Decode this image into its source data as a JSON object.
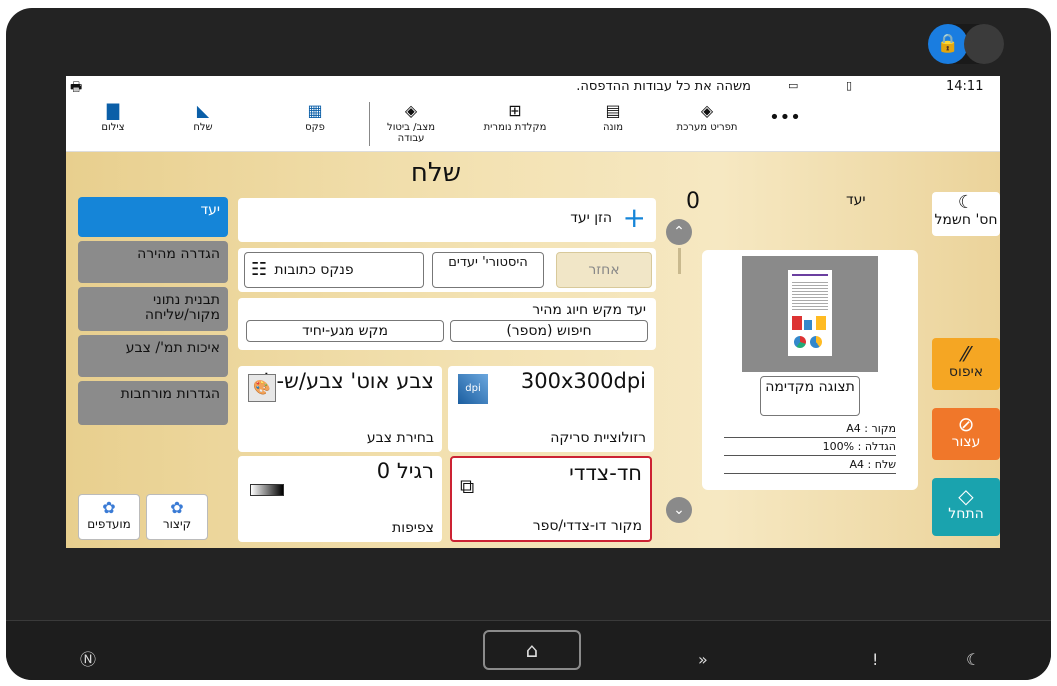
{
  "status": {
    "message": "משהה את כל עבודות ההדפסה.",
    "time": "14:11"
  },
  "toolbar": [
    {
      "label": "צילום",
      "icon": "copy-icon"
    },
    {
      "label": "שלח",
      "icon": "send-icon"
    },
    {
      "label": "פקס",
      "icon": "fax-icon"
    },
    {
      "label": "מצב/ ביטול עבודה",
      "icon": "job-status-icon"
    },
    {
      "label": "מקלדת נומרית",
      "icon": "numeric-keypad-icon"
    },
    {
      "label": "מונה",
      "icon": "counter-icon"
    },
    {
      "label": "תפריט מערכת",
      "icon": "system-menu-icon"
    },
    {
      "label": "•••",
      "icon": "more-icon"
    }
  ],
  "title": "שלח",
  "left_tabs": [
    "יעד",
    "הגדרה מהירה",
    "תבנית נתוני מקור/שליחה",
    "איכות תמ'/ צבע",
    "הגדרות מורחבות"
  ],
  "bottom_buttons": {
    "favorites": "מועדפים",
    "shortcut": "קיצור"
  },
  "destination": {
    "add": "הזן יעד",
    "count": "0",
    "label": "יעד",
    "back": "אחזר",
    "history": "היסטורי' יעדים",
    "address_book": "פנקס כתובות",
    "quick_dial": "יעד מקש חיוג מהיר",
    "search_number": "חיפוש (מספר)",
    "one_touch": "מקש מגע-יחיד"
  },
  "cards": [
    {
      "id": "resolution",
      "title": "300x300dpi",
      "sub": "רזולוציית סריקה",
      "icon": "dpi-icon"
    },
    {
      "id": "color",
      "title": "צבע אוט' צבע/ש-ל",
      "sub": "בחירת צבע",
      "icon": "color-select-icon"
    },
    {
      "id": "duplex",
      "title": "חד-צדדי",
      "sub": "מקור דו-צדדי/ספר",
      "icon": "duplex-icon"
    },
    {
      "id": "density",
      "title": "רגיל 0",
      "sub": "צפיפות",
      "icon": "density-icon"
    }
  ],
  "preview": {
    "button": "תצוגה מקדימה",
    "original": "מקור : A4",
    "zoom": "הגדלה : 100%",
    "send": "שלח : A4"
  },
  "right_buttons": {
    "energy": "חס' חשמל",
    "reset": "איפוס",
    "stop": "עצור",
    "start": "התחל"
  },
  "colors": {
    "accent": "#1585d8",
    "reset": "#f5a623",
    "stop": "#f0772a",
    "start": "#1aa3ae"
  }
}
